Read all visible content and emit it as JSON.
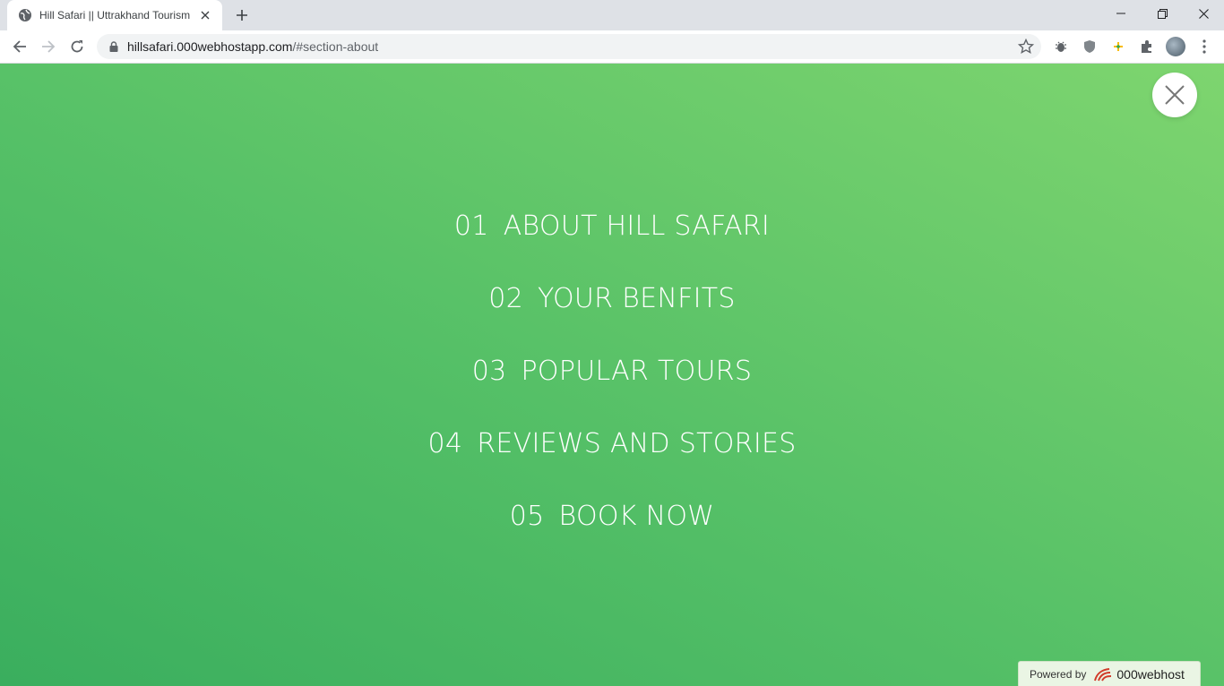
{
  "browser": {
    "tab": {
      "title": "Hill Safari || Uttrakhand Tourism"
    },
    "address": {
      "host": "hillsafari.000webhostapp.com",
      "path": "/#section-about"
    }
  },
  "menu": {
    "items": [
      {
        "num": "01",
        "label": "ABOUT HILL SAFARI"
      },
      {
        "num": "02",
        "label": "YOUR BENFITS"
      },
      {
        "num": "03",
        "label": "POPULAR TOURS"
      },
      {
        "num": "04",
        "label": "REVIEWS AND STORIES"
      },
      {
        "num": "05",
        "label": "BOOK NOW"
      }
    ]
  },
  "badge": {
    "powered_by": "Powered by",
    "brand": "000webhost"
  },
  "colors": {
    "gradient_start": "#3aae5e",
    "gradient_end": "#7ed56f",
    "text": "#ffffff"
  }
}
